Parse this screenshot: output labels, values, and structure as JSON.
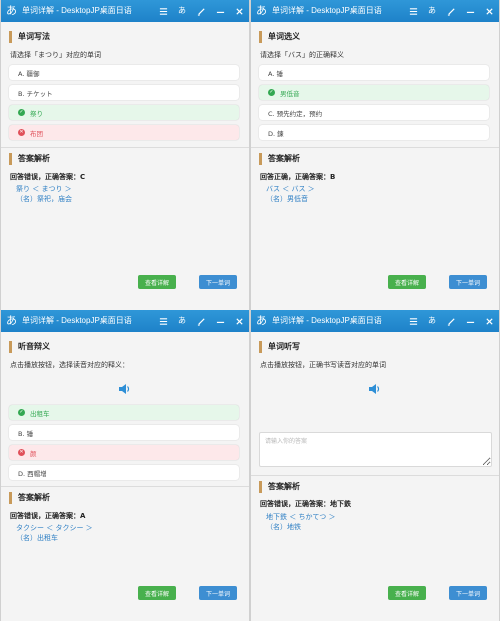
{
  "app_title": "单词详解 - DesktopJP桌面日语",
  "titlebar_icons": [
    "list-icon",
    "translate-icon",
    "brush-icon",
    "minimize-icon",
    "close-icon"
  ],
  "common": {
    "analysis_heading": "答案解析",
    "detail_button": "查看详解",
    "next_button": "下一单词"
  },
  "panels": [
    {
      "section_title": "单词写法",
      "question": "请选择「まつり」对应的单词",
      "options": [
        {
          "label": "A. 疆御",
          "state": "normal"
        },
        {
          "label": "B. チケット",
          "state": "normal"
        },
        {
          "label": "祭り",
          "state": "correct"
        },
        {
          "label": "布团",
          "state": "wrong"
        }
      ],
      "result": "回答错误，正确答案：C",
      "entry_word": "祭り ＜ まつり ＞",
      "entry_meaning": "（名）祭祀，庙会"
    },
    {
      "section_title": "单词选义",
      "question": "请选择「バス」的正确释义",
      "options": [
        {
          "label": "A. 锤",
          "state": "normal"
        },
        {
          "label": "男低音",
          "state": "correct"
        },
        {
          "label": "C. 预先约定，预约",
          "state": "normal"
        },
        {
          "label": "D. 鍊",
          "state": "normal"
        }
      ],
      "result": "回答正确，正确答案：B",
      "entry_word": "バス ＜ バス ＞",
      "entry_meaning": "（名）男低音"
    },
    {
      "section_title": "听音辩义",
      "question": "点击播放按钮，选择读音对应的释义：",
      "options": [
        {
          "label": "出租车",
          "state": "correct"
        },
        {
          "label": "B. 锤",
          "state": "normal"
        },
        {
          "label": "颜",
          "state": "wrong"
        },
        {
          "label": "D. 西帽增",
          "state": "normal"
        }
      ],
      "result": "回答错误，正确答案：A",
      "entry_word": "タクシー ＜ タクシー ＞",
      "entry_meaning": "（名）出租车"
    },
    {
      "section_title": "单词听写",
      "question": "点击播放按钮，正确书写读音对应的单词",
      "input_placeholder": "请输入你的答案",
      "input_value": "",
      "result": "回答错误，正确答案：地下鉄",
      "entry_word": "地下鉄 ＜ ちかてつ ＞",
      "entry_meaning": "（名）地铁"
    }
  ],
  "colors": {
    "titlebar": "#1e82c9",
    "correct": "#33a852",
    "wrong": "#e0505a",
    "accent_bar": "#c89a5a",
    "link_blue": "#2e7fc4",
    "detail_button": "#48b04d",
    "next_button": "#3d8ed2"
  }
}
